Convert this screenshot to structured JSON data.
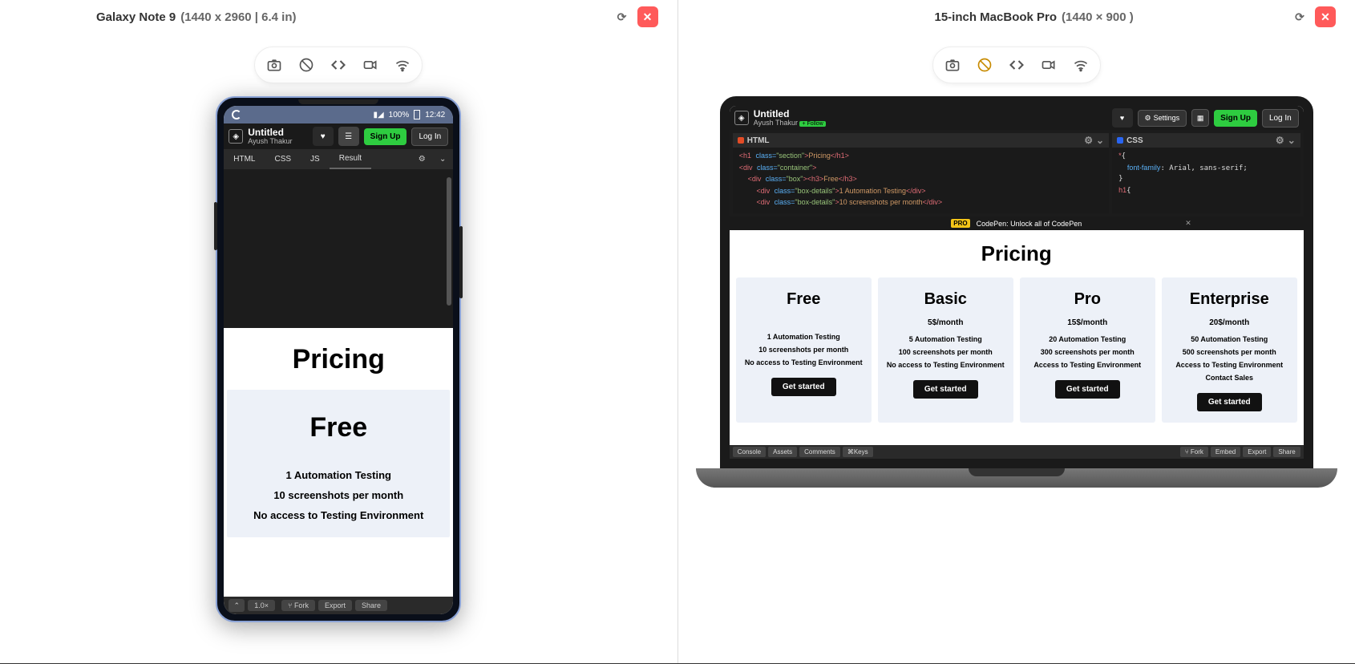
{
  "left": {
    "device_name": "Galaxy Note 9",
    "device_spec": "(1440 x 2960 | 6.4 in)",
    "statusbar": {
      "signal": "📶",
      "battery": "100%",
      "time": "12:42"
    },
    "codepen": {
      "title": "Untitled",
      "author": "Ayush Thakur",
      "signup": "Sign Up",
      "login": "Log In",
      "tabs": {
        "html": "HTML",
        "css": "CSS",
        "js": "JS",
        "result": "Result"
      },
      "footer": {
        "zoom": "1.0×",
        "fork": "Fork",
        "export": "Export",
        "share": "Share"
      }
    },
    "preview": {
      "heading": "Pricing",
      "plan": "Free",
      "lines": [
        "1 Automation Testing",
        "10 screenshots per month",
        "No access to Testing Environment"
      ]
    }
  },
  "right": {
    "device_name": "15-inch MacBook Pro",
    "device_spec": "(1440 × 900 )",
    "codepen": {
      "title": "Untitled",
      "author": "Ayush Thakur",
      "settings": "Settings",
      "signup": "Sign Up",
      "login": "Log In",
      "html_label": "HTML",
      "css_label": "CSS",
      "promo": "CodePen: Unlock all of CodePen",
      "footer": {
        "console": "Console",
        "assets": "Assets",
        "comments": "Comments",
        "keys": "⌘Keys",
        "fork": "Fork",
        "embed": "Embed",
        "export": "Export",
        "share": "Share"
      }
    },
    "preview": {
      "heading": "Pricing",
      "plans": [
        {
          "name": "Free",
          "price": "",
          "f": [
            "1 Automation Testing",
            "10 screenshots per month",
            "No access to Testing Environment"
          ],
          "cta": "Get started"
        },
        {
          "name": "Basic",
          "price": "5$/month",
          "f": [
            "5 Automation Testing",
            "100 screenshots per month",
            "No access to Testing Environment"
          ],
          "cta": "Get started"
        },
        {
          "name": "Pro",
          "price": "15$/month",
          "f": [
            "20 Automation Testing",
            "300 screenshots per month",
            "Access to Testing Environment"
          ],
          "cta": "Get started"
        },
        {
          "name": "Enterprise",
          "price": "20$/month",
          "f": [
            "50 Automation Testing",
            "500 screenshots per month",
            "Access to Testing Environment",
            "Contact Sales"
          ],
          "cta": "Get started"
        }
      ]
    }
  }
}
